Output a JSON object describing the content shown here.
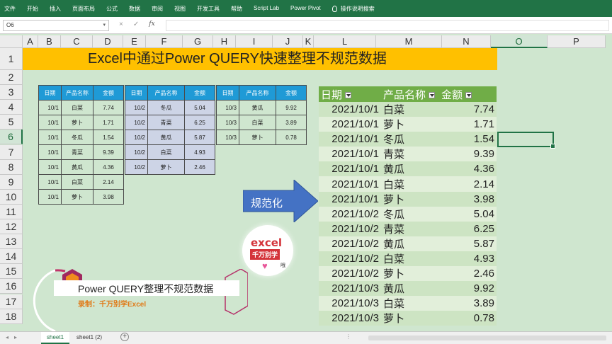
{
  "ribbon": {
    "tabs": [
      "文件",
      "开始",
      "插入",
      "页面布局",
      "公式",
      "数据",
      "审阅",
      "视图",
      "开发工具",
      "帮助",
      "Script Lab",
      "Power Pivot"
    ],
    "tell_me": "操作说明搜索"
  },
  "formula_bar": {
    "name_box": "O6",
    "cancel_icon": "×",
    "enter_icon": "✓",
    "fx_label": "fx",
    "formula": ""
  },
  "columns": [
    {
      "label": "A",
      "w": 22
    },
    {
      "label": "B",
      "w": 32
    },
    {
      "label": "C",
      "w": 45
    },
    {
      "label": "D",
      "w": 43
    },
    {
      "label": "E",
      "w": 32
    },
    {
      "label": "F",
      "w": 52
    },
    {
      "label": "G",
      "w": 43
    },
    {
      "label": "H",
      "w": 32
    },
    {
      "label": "I",
      "w": 52
    },
    {
      "label": "J",
      "w": 43
    },
    {
      "label": "K",
      "w": 15
    },
    {
      "label": "L",
      "w": 88
    },
    {
      "label": "M",
      "w": 93
    },
    {
      "label": "N",
      "w": 69
    },
    {
      "label": "O",
      "w": 80
    },
    {
      "label": "P",
      "w": 82
    }
  ],
  "rows": [
    "1",
    "2",
    "3",
    "4",
    "5",
    "6",
    "7",
    "8",
    "9",
    "10",
    "11",
    "12",
    "13",
    "14",
    "15",
    "16",
    "17",
    "18"
  ],
  "selected": {
    "column": "O",
    "row": "6"
  },
  "title": "Excel中通过Power QUERY快速整理不规范数据",
  "source_headers": [
    "日期",
    "产品名称",
    "金额"
  ],
  "source_tables": [
    {
      "rows": [
        [
          "10/1",
          "白菜",
          "7.74"
        ],
        [
          "10/1",
          "萝卜",
          "1.71"
        ],
        [
          "10/1",
          "冬瓜",
          "1.54"
        ],
        [
          "10/1",
          "青菜",
          "9.39"
        ],
        [
          "10/1",
          "黄瓜",
          "4.36"
        ],
        [
          "10/1",
          "白菜",
          "2.14"
        ],
        [
          "10/1",
          "萝卜",
          "3.98"
        ]
      ]
    },
    {
      "rows": [
        [
          "10/2",
          "冬瓜",
          "5.04"
        ],
        [
          "10/2",
          "青菜",
          "6.25"
        ],
        [
          "10/2",
          "黄瓜",
          "5.87"
        ],
        [
          "10/2",
          "白菜",
          "4.93"
        ],
        [
          "10/2",
          "萝卜",
          "2.46"
        ]
      ]
    },
    {
      "rows": [
        [
          "10/3",
          "黄瓜",
          "9.92"
        ],
        [
          "10/3",
          "白菜",
          "3.89"
        ],
        [
          "10/3",
          "萝卜",
          "0.78"
        ]
      ]
    }
  ],
  "arrow_label": "规范化",
  "result": {
    "headers": [
      "日期",
      "产品名称",
      "金额"
    ],
    "rows": [
      [
        "2021/10/1",
        "白菜",
        "7.74"
      ],
      [
        "2021/10/1",
        "萝卜",
        "1.71"
      ],
      [
        "2021/10/1",
        "冬瓜",
        "1.54"
      ],
      [
        "2021/10/1",
        "青菜",
        "9.39"
      ],
      [
        "2021/10/1",
        "黄瓜",
        "4.36"
      ],
      [
        "2021/10/1",
        "白菜",
        "2.14"
      ],
      [
        "2021/10/1",
        "萝卜",
        "3.98"
      ],
      [
        "2021/10/2",
        "冬瓜",
        "5.04"
      ],
      [
        "2021/10/2",
        "青菜",
        "6.25"
      ],
      [
        "2021/10/2",
        "黄瓜",
        "5.87"
      ],
      [
        "2021/10/2",
        "白菜",
        "4.93"
      ],
      [
        "2021/10/2",
        "萝卜",
        "2.46"
      ],
      [
        "2021/10/3",
        "黄瓜",
        "9.92"
      ],
      [
        "2021/10/3",
        "白菜",
        "3.89"
      ],
      [
        "2021/10/3",
        "萝卜",
        "0.78"
      ]
    ]
  },
  "logo": {
    "brand": "excel",
    "name": "千万别学",
    "small": "哦"
  },
  "overlay": {
    "title": "Power QUERY整理不规范数据",
    "subtitle": "录制：千万别学Excel"
  },
  "sheets": [
    {
      "name": "sheet1",
      "active": true
    },
    {
      "name": "sheet1 (2)",
      "active": false
    }
  ],
  "colors": {
    "ribbon": "#217346",
    "sheet_bg": "#cfe6cf",
    "banner": "#ffc000",
    "src_header": "#1f9ad6",
    "table2_fill": "#cdd4e6",
    "result_header": "#70ad47",
    "arrow": "#4472c4"
  }
}
